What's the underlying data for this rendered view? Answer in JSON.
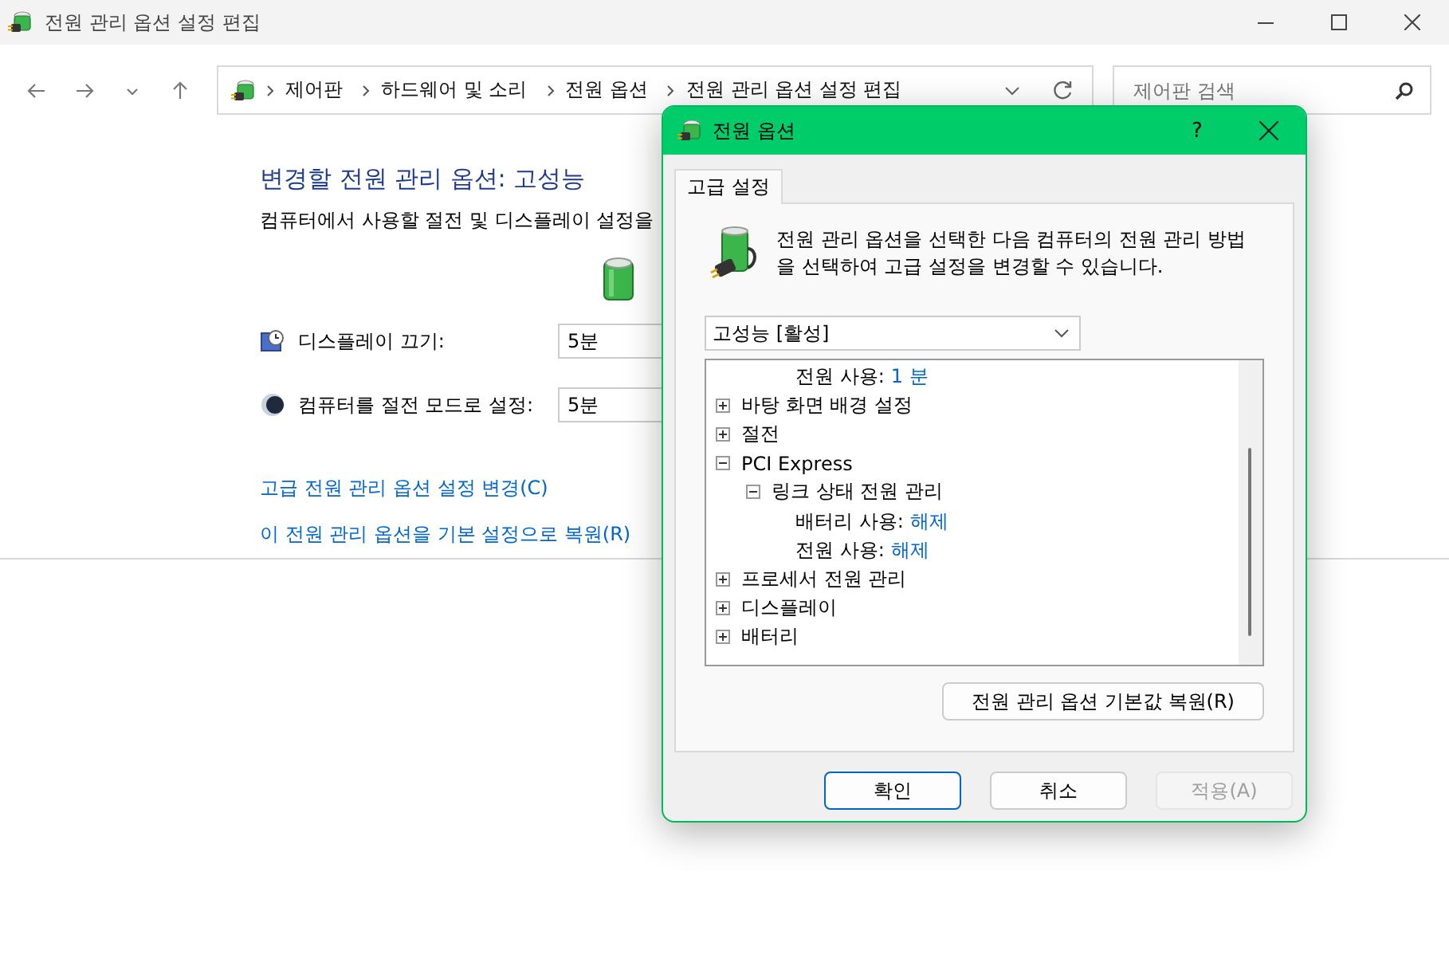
{
  "window": {
    "title": "전원 관리 옵션 설정 편집"
  },
  "address_bar": {
    "crumbs": [
      "제어판",
      "하드웨어 및 소리",
      "전원 옵션",
      "전원 관리 옵션 설정 편집"
    ]
  },
  "search": {
    "placeholder": "제어판 검색"
  },
  "plan": {
    "heading": "변경할 전원 관리 옵션: 고성능",
    "description": "컴퓨터에서 사용할 절전 및 디스플레이 설정을",
    "settings": [
      {
        "kind": "display",
        "label": "디스플레이 끄기:",
        "value": "5분"
      },
      {
        "kind": "sleep",
        "label": "컴퓨터를 절전 모드로 설정:",
        "value": "5분"
      }
    ],
    "links": [
      "고급 전원 관리 옵션 설정 변경(C)",
      "이 전원 관리 옵션을 기본 설정으로 복원(R)"
    ]
  },
  "dialog": {
    "title": "전원 옵션",
    "help": "?",
    "tabs": [
      {
        "label": "고급 설정",
        "selected": true
      }
    ],
    "intro": "전원 관리 옵션을 선택한 다음 컴퓨터의 전원 관리 방법을 선택하여 고급 설정을 변경할 수 있습니다.",
    "plan_select": {
      "value": "고성능 [활성]"
    },
    "tree": [
      {
        "kind": "setting",
        "label": "전원 사용:",
        "value": "1 분"
      },
      {
        "kind": "group",
        "label": "바탕 화면 배경 설정",
        "expanded": false
      },
      {
        "kind": "group",
        "label": "절전",
        "expanded": false
      },
      {
        "kind": "group",
        "label": "PCI Express",
        "expanded": true,
        "children": [
          {
            "kind": "group",
            "label": "링크 상태 전원 관리",
            "expanded": true,
            "children": [
              {
                "kind": "setting",
                "label": "배터리 사용:",
                "value": "해제"
              },
              {
                "kind": "setting",
                "label": "전원 사용:",
                "value": "해제"
              }
            ]
          }
        ]
      },
      {
        "kind": "group",
        "label": "프로세서 전원 관리",
        "expanded": false
      },
      {
        "kind": "group",
        "label": "디스플레이",
        "expanded": false
      },
      {
        "kind": "group",
        "label": "배터리",
        "expanded": false
      }
    ],
    "restore_button": "전원 관리 옵션 기본값 복원(R)",
    "buttons": [
      {
        "label": "확인",
        "default": true,
        "disabled": false
      },
      {
        "label": "취소",
        "default": false,
        "disabled": false
      },
      {
        "label": "적용(A)",
        "default": false,
        "disabled": true
      }
    ]
  }
}
